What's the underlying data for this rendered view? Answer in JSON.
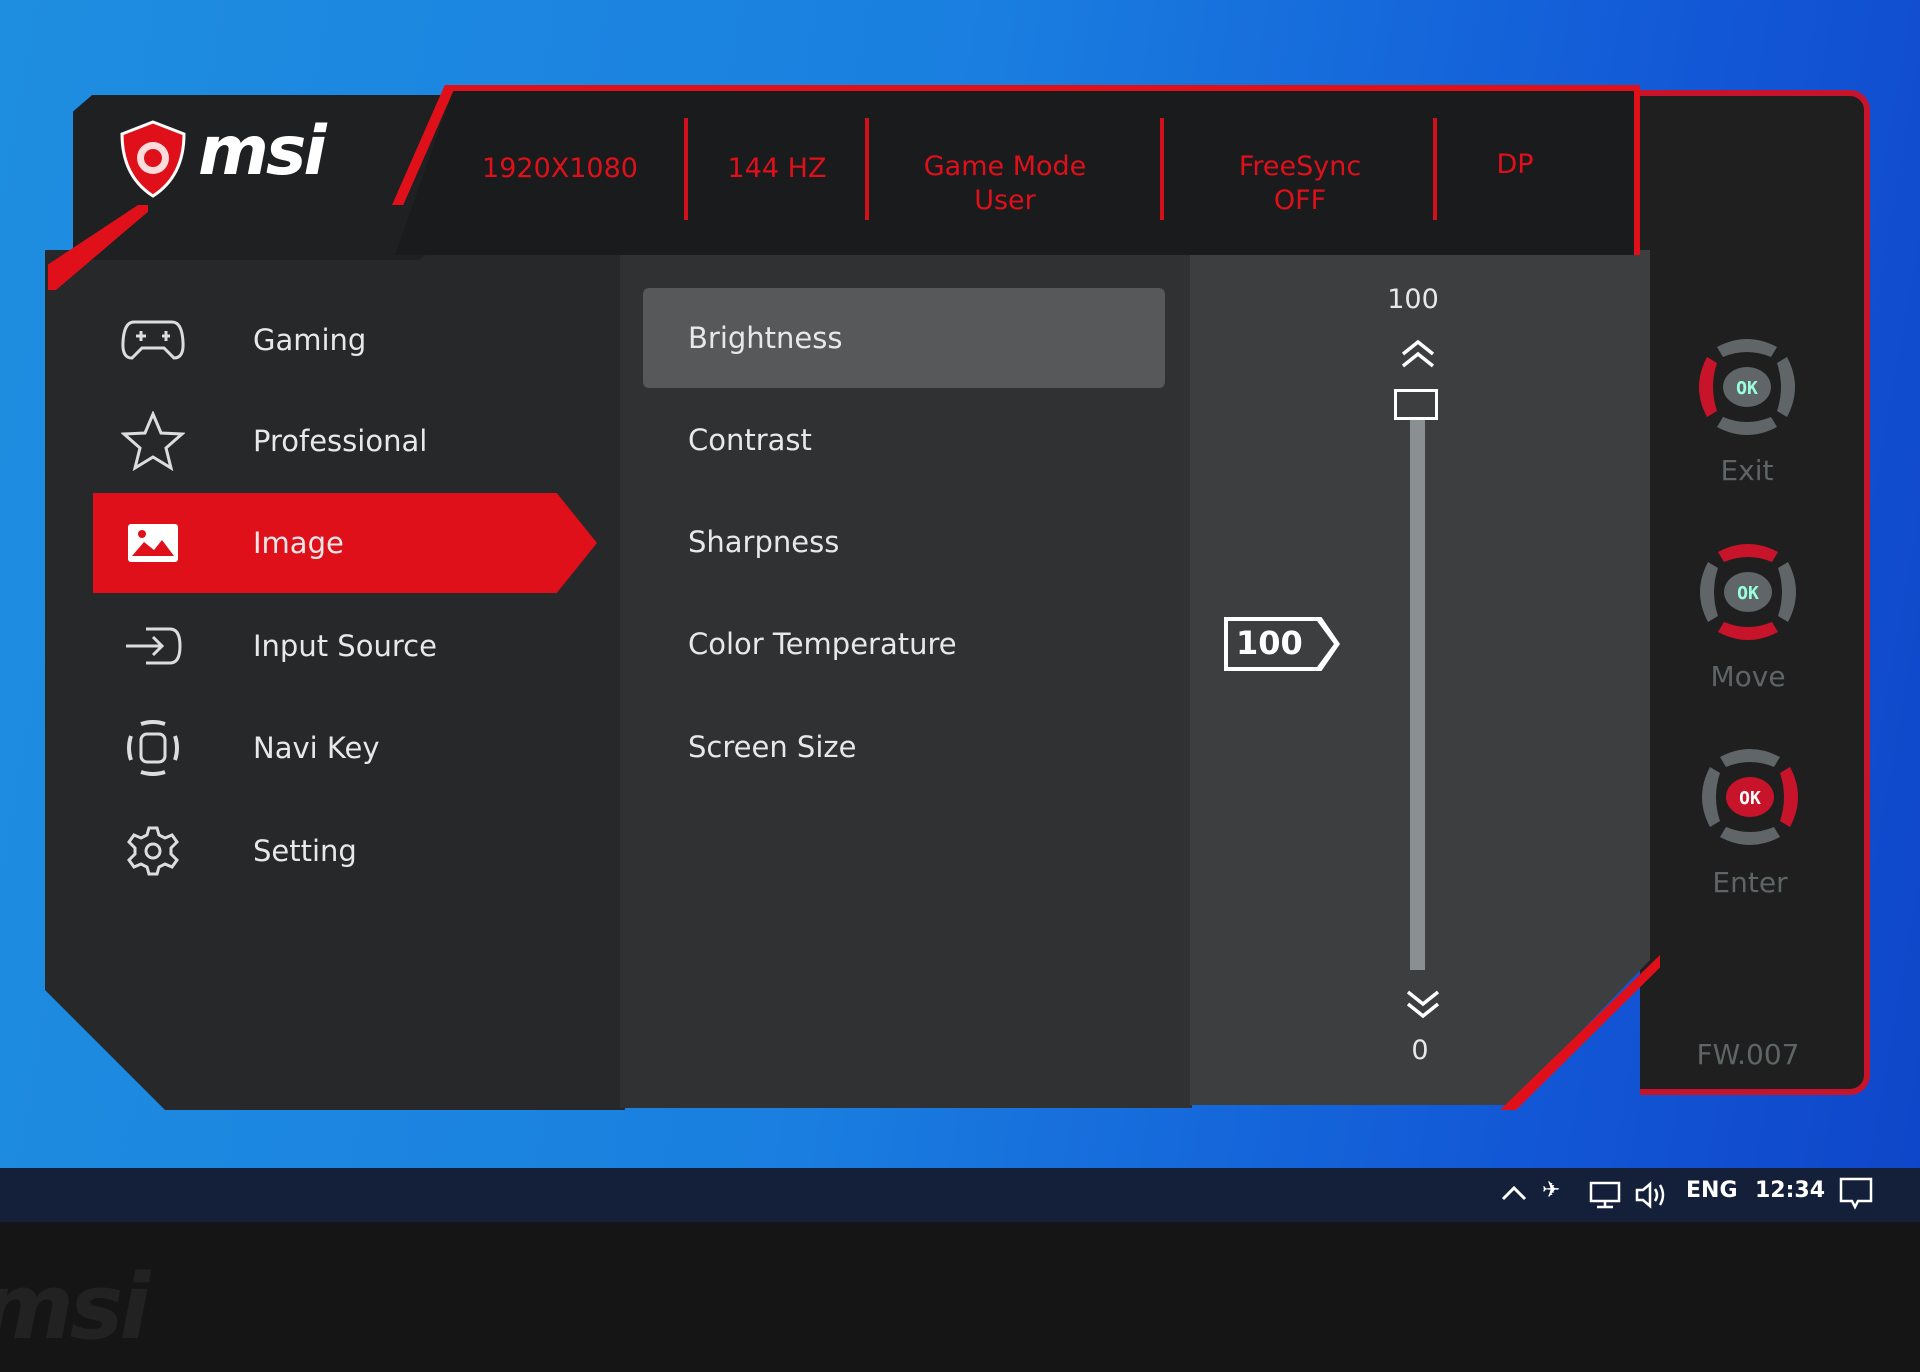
{
  "brand": {
    "logo_text": "msi"
  },
  "header": {
    "resolution": "1920X1080",
    "refresh": "144 HZ",
    "game_mode_line1": "Game Mode",
    "game_mode_line2": "User",
    "freesync_line1": "FreeSync",
    "freesync_line2": "OFF",
    "input": "DP"
  },
  "sidebar": {
    "items": [
      {
        "label": "Gaming",
        "icon": "gamepad-icon"
      },
      {
        "label": "Professional",
        "icon": "star-icon"
      },
      {
        "label": "Image",
        "icon": "image-icon",
        "selected": true
      },
      {
        "label": "Input Source",
        "icon": "input-icon"
      },
      {
        "label": "Navi Key",
        "icon": "navi-key-icon"
      },
      {
        "label": "Setting",
        "icon": "gear-icon"
      }
    ]
  },
  "submenu": {
    "items": [
      {
        "label": "Brightness",
        "selected": true
      },
      {
        "label": "Contrast"
      },
      {
        "label": "Sharpness"
      },
      {
        "label": "Color Temperature"
      },
      {
        "label": "Screen Size"
      }
    ]
  },
  "slider": {
    "max_label": "100",
    "min_label": "0",
    "value": 100,
    "value_label": "100"
  },
  "remote": {
    "ok": "OK",
    "exit": "Exit",
    "move": "Move",
    "enter": "Enter",
    "firmware": "FW.007"
  },
  "taskbar": {
    "language": "ENG",
    "time": "12:34"
  },
  "colors": {
    "accent": "#e0101a",
    "panel": "#26282a",
    "highlight": "#56585a"
  }
}
